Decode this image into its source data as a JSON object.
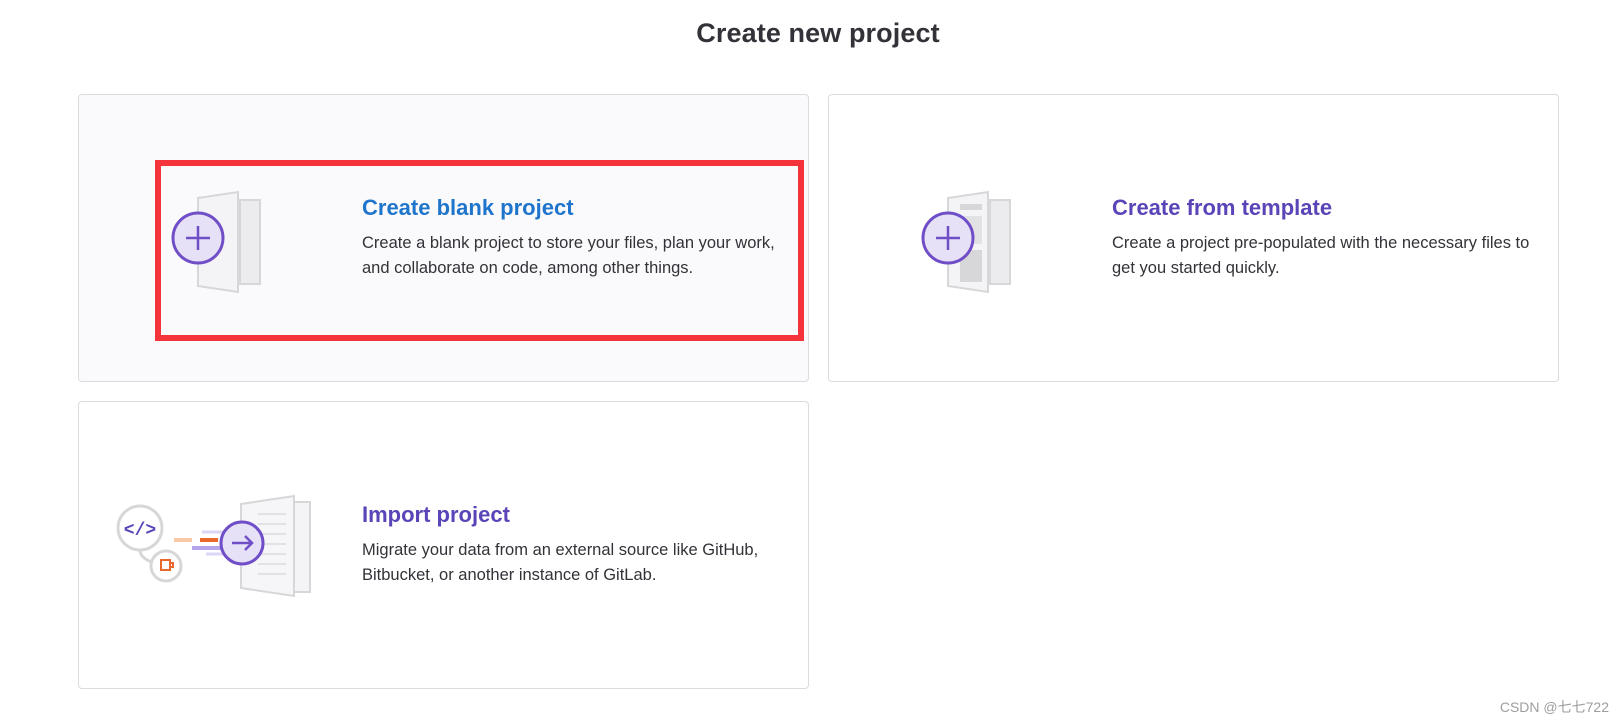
{
  "page": {
    "title": "Create new project"
  },
  "cards": [
    {
      "title": "Create blank project",
      "description": "Create a blank project to store your files, plan your work, and collaborate on code, among other things.",
      "icon": "blank-project-illustration-icon"
    },
    {
      "title": "Create from template",
      "description": "Create a project pre-populated with the necessary files to get you started quickly.",
      "icon": "template-project-illustration-icon"
    },
    {
      "title": "Import project",
      "description": "Migrate your data from an external source like GitHub, Bitbucket, or another instance of GitLab.",
      "icon": "import-project-illustration-icon"
    }
  ],
  "watermark": "CSDN @七七722",
  "colors": {
    "accent": "#5b44b8",
    "hover_title": "#1f75cb",
    "annotation": "#f5333b",
    "border": "#dcdcde"
  }
}
